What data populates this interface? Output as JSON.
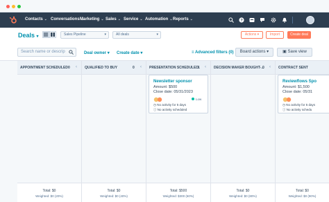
{
  "nav": {
    "items": [
      {
        "label": "Contacts"
      },
      {
        "label": "Conversations"
      },
      {
        "label": "Marketing"
      },
      {
        "label": "Sales"
      },
      {
        "label": "Service"
      },
      {
        "label": "Automation"
      },
      {
        "label": "Reports"
      }
    ],
    "icons": [
      "search-icon",
      "help-icon",
      "marketplace-icon",
      "notifications-settings-icon",
      "settings-icon",
      "bell-icon"
    ]
  },
  "header": {
    "title": "Deals",
    "pipeline": "Sales Pipeline",
    "deals_filter": "All deals",
    "actions_label": "Actions",
    "import_label": "Import",
    "create_label": "Create deal"
  },
  "filters": {
    "search_placeholder": "Search name or descrip",
    "deal_owner": "Deal owner",
    "create_date": "Create date",
    "advanced": "Advanced filters (0)",
    "board_actions": "Board actions",
    "save_view": "Save view"
  },
  "columns": [
    {
      "name": "APPOINTMENT SCHEDULED",
      "count": "0",
      "total": "Total: $0",
      "weighted": "Weighted: $0 (20%)"
    },
    {
      "name": "QUALIFIED TO BUY",
      "count": "0",
      "total": "Total: $0",
      "weighted": "Weighted: $0 (40%)"
    },
    {
      "name": "PRESENTATION SCHEDULED",
      "count": "1",
      "total": "Total: $500",
      "weighted": "Weighted: $300 (60%)"
    },
    {
      "name": "DECISION MAKER BOUGHT-...",
      "count": "0",
      "total": "Total: $0",
      "weighted": "Weighted: $0 (80%)"
    },
    {
      "name": "CONTRACT SENT",
      "count": "",
      "total": "Total: $0",
      "weighted": "Weighted: $0 (90%)"
    }
  ],
  "cards": [
    {
      "name": "Newsletter sponsor",
      "amount": "Amount: $500",
      "close_date": "Close date: 05/31/2023",
      "priority": "Low",
      "activity": "No activity for 5 days",
      "scheduled": "No activity scheduled"
    },
    {
      "name": "Reviewflows Spo",
      "amount": "Amount: $1,500",
      "close_date": "Close date: 05/31",
      "priority": "",
      "activity": "No activity for 5 days",
      "scheduled": "No activity schedu"
    }
  ],
  "colors": {
    "nav_bg": "#2d3e50",
    "accent": "#ff7a59",
    "link": "#0091ae",
    "board_bg": "#f5f8fa"
  }
}
